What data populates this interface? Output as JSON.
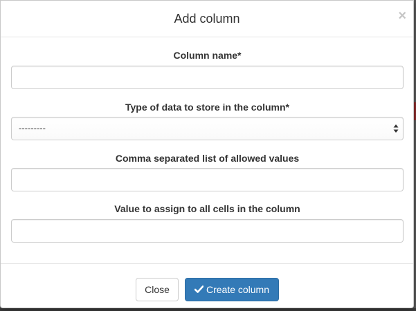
{
  "modal": {
    "title": "Add column",
    "close_glyph": "×"
  },
  "fields": {
    "column_name": {
      "label": "Column name*",
      "value": ""
    },
    "data_type": {
      "label": "Type of data to store in the column*",
      "selected": "---------"
    },
    "allowed_values": {
      "label": "Comma separated list of allowed values",
      "value": ""
    },
    "initial_value": {
      "label": "Value to assign to all cells in the column",
      "value": ""
    }
  },
  "footer": {
    "close_label": "Close",
    "create_label": "Create column"
  },
  "icons": {
    "close": "close-icon",
    "check": "check-icon",
    "select_arrows": "select-arrows-icon"
  },
  "colors": {
    "primary": "#337ab7",
    "primary_border": "#2e6da4",
    "close_icon": "#c4c4c4"
  }
}
